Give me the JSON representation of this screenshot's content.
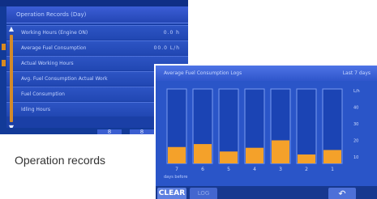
{
  "back_screen": {
    "title": "Operation Records (Day)",
    "rows": [
      {
        "label": "Working Hours (Engine ON)",
        "value": "0.0 h"
      },
      {
        "label": "Average Fuel Consumption",
        "value": "00.0 L/h"
      },
      {
        "label": "Actual Working Hours",
        "value": ""
      },
      {
        "label": "Avg. Fuel Consumption Actual Work",
        "value": ""
      },
      {
        "label": "Fuel Consumption",
        "value": ""
      },
      {
        "label": "Idling Hours",
        "value": ""
      }
    ],
    "footer_buttons": [
      "8",
      "8"
    ]
  },
  "caption": "Operation records",
  "front_screen": {
    "title": "Average Fuel Consumption Logs",
    "title_right": "Last 7 days",
    "x_caption": "days before",
    "clear_label": "CLEAR",
    "secondary_label": "LOG",
    "return_icon": "return-arrow-icon"
  },
  "chart_data": {
    "type": "bar",
    "categories": [
      "7",
      "6",
      "5",
      "4",
      "3",
      "2",
      "1"
    ],
    "values": [
      0.22,
      0.26,
      0.16,
      0.21,
      0.31,
      0.12,
      0.18
    ],
    "ylim": [
      0,
      1
    ],
    "y_tick_labels": [
      "L/h",
      "40",
      "30",
      "20",
      "10"
    ],
    "xlabel": "days before",
    "bar_color": "#f4a12a",
    "track_color": "#1b44b4"
  }
}
